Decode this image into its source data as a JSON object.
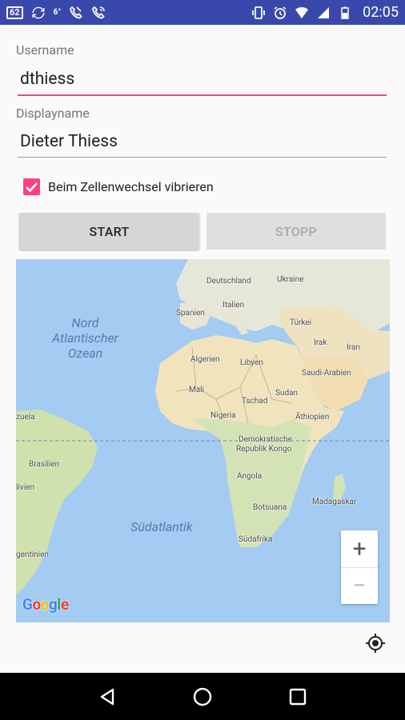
{
  "status_bar": {
    "notif_number": "62",
    "small_label": "6°",
    "clock": "02:05",
    "color": "#3949ab"
  },
  "form": {
    "username_label": "Username",
    "username_value": "dthiess",
    "displayname_label": "Displayname",
    "displayname_value": "Dieter Thiess",
    "checkbox_label": "Beim Zellenwechsel vibrieren",
    "checkbox_checked": true,
    "start_label": "START",
    "stopp_label": "STOPP",
    "accent_color": "#ff4081"
  },
  "map": {
    "labels": {
      "deutschland": "Deutschland",
      "ukraine": "Ukraine",
      "spanien": "Spanien",
      "italien": "Italien",
      "turkei": "Türkei",
      "irak": "Irak",
      "iran": "Iran",
      "algerien": "Algerien",
      "libyen": "Libyen",
      "saudi": "Saudi-Arabien",
      "mali": "Mali",
      "tschad": "Tschad",
      "sudan": "Sudan",
      "nigeria": "Nigeria",
      "athiopien": "Äthiopien",
      "zuela": "zuela",
      "kongo1": "Demokratische",
      "kongo2": "Republik Kongo",
      "brasilien": "Brasilien",
      "angola": "Angola",
      "livien": "livien",
      "madagaskar": "Madagaskar",
      "botsuana": "Botsuana",
      "sudafrika": "Südafrika",
      "gentinien": "gentinien"
    },
    "oceans": {
      "nord1": "Nord",
      "nord2": "Atlantischer",
      "nord3": "Ozean",
      "sud": "Südatlantik"
    },
    "zoom_in": "+",
    "zoom_out": "−",
    "logo": "Google"
  }
}
